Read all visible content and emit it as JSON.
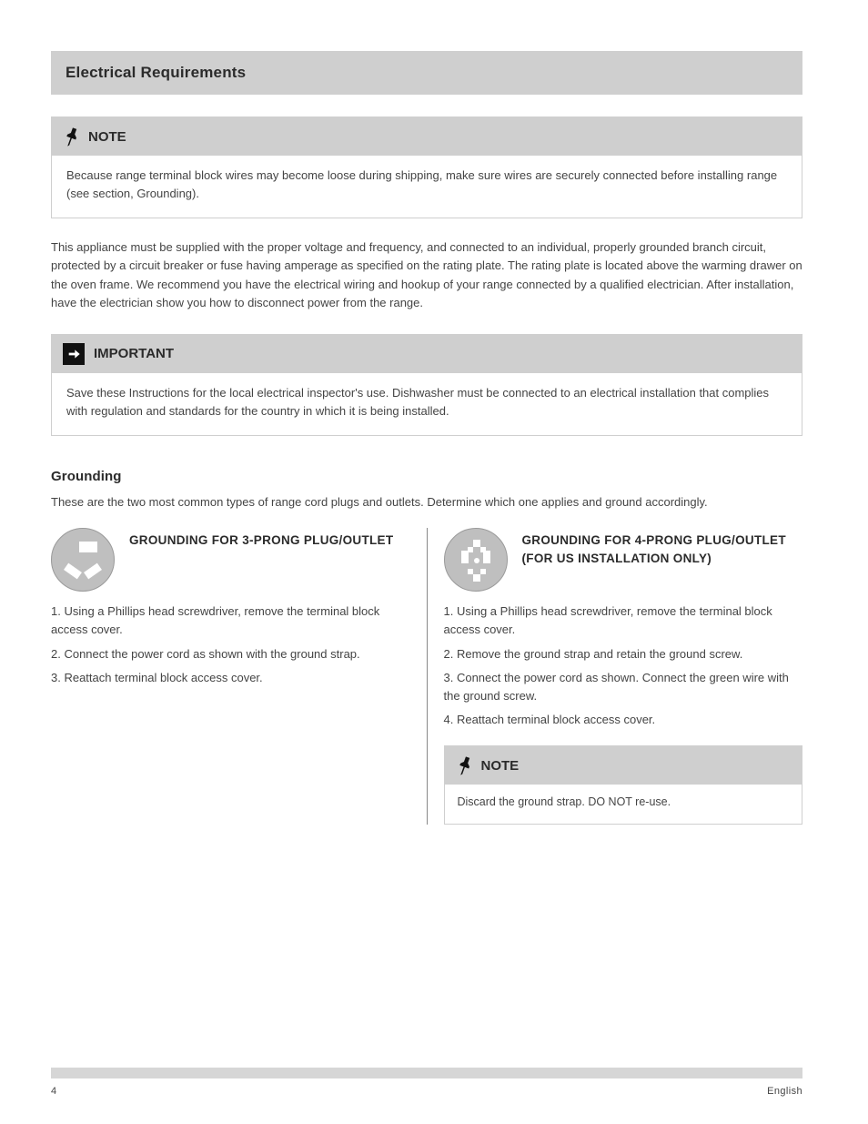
{
  "header": {
    "title": "Electrical Requirements"
  },
  "note1": {
    "label": "NOTE",
    "body": "Because range terminal block wires may become loose during shipping, make sure wires are securely connected before installing range (see section, Grounding)."
  },
  "intro": "This appliance must be supplied with the proper voltage and frequency, and connected to an individual, properly grounded branch circuit, protected by a circuit breaker or fuse having amperage as specified on the rating plate.  The rating plate is located above the warming drawer on the oven frame.  We recommend you have the electrical wiring and hookup of your range connected by a qualified electrician.  After installation, have the electrician show you how to disconnect power from the range.",
  "important": {
    "label": "IMPORTANT",
    "body": "Save these Instructions for the local electrical inspector's use.  Dishwasher must be connected to an electrical installation that complies with regulation and standards for the country in which it is being installed."
  },
  "grounding_title": "Grounding",
  "grounding_para": "These are the two most common types of range cord plugs and outlets.  Determine which one applies and ground accordingly.",
  "col3": {
    "title": "GROUNDING FOR 3-PRONG PLUG/OUTLET",
    "items": [
      "1.  Using a Phillips head screwdriver, remove the terminal block access cover.",
      "2.  Connect the power cord as shown with the ground strap.",
      "3.  Reattach terminal block access cover."
    ]
  },
  "col4": {
    "title": "GROUNDING FOR 4-PRONG PLUG/OUTLET (FOR US INSTALLATION ONLY)",
    "items": [
      "1.  Using a Phillips head screwdriver, remove the terminal block access cover.",
      "2.  Remove the ground strap and retain the ground screw.",
      "3.  Connect the power cord as shown.  Connect the green wire with the ground screw.",
      "4.  Reattach terminal block access cover."
    ]
  },
  "note2": {
    "label": "NOTE",
    "body": "Discard the ground strap.  DO NOT re-use."
  },
  "footer": {
    "left": "4",
    "right": "English"
  }
}
